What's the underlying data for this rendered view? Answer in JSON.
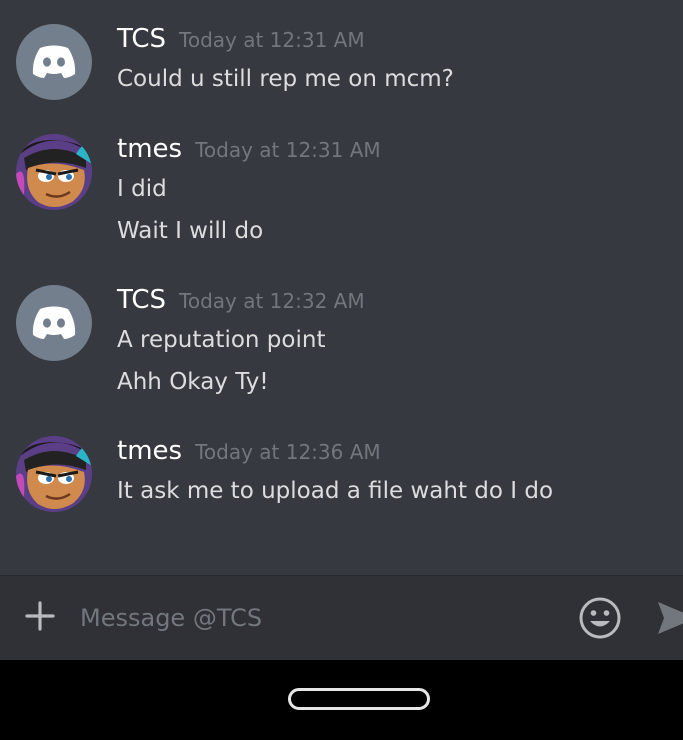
{
  "messages": [
    {
      "author": "TCS",
      "timestamp": "Today at 12:31 AM",
      "avatar_icon": "discord-default-avatar-icon",
      "lines": [
        "Could u still rep me on mcm?"
      ]
    },
    {
      "author": "tmes",
      "timestamp": "Today at 12:31 AM",
      "avatar_icon": "cartoon-avatar",
      "lines": [
        "I did",
        "Wait I will do"
      ]
    },
    {
      "author": "TCS",
      "timestamp": "Today at 12:32 AM",
      "avatar_icon": "discord-default-avatar-icon",
      "lines": [
        "A reputation point",
        "Ahh Okay Ty!"
      ]
    },
    {
      "author": "tmes",
      "timestamp": "Today at 12:36 AM",
      "avatar_icon": "cartoon-avatar",
      "lines": [
        "It ask me to upload a file waht do I do"
      ]
    }
  ],
  "composer": {
    "placeholder": "Message @TCS",
    "value": "",
    "plus_icon": "plus-icon",
    "emoji_icon": "emoji-icon",
    "send_icon": "send-icon"
  },
  "colors": {
    "chat_bg": "#36393f",
    "composer_bg": "#2f3136",
    "default_avatar": "#747f8d",
    "username": "#ffffff",
    "timestamp": "#72767d",
    "message_text": "#dcddde"
  }
}
